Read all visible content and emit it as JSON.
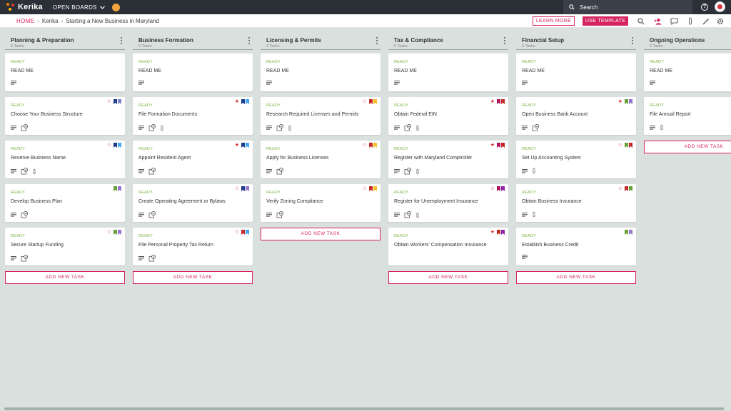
{
  "topbar": {
    "app_name": "Kerika",
    "open_boards_label": "OPEN BOARDS",
    "search_placeholder": "Search"
  },
  "breadcrumb": {
    "home": "HOME",
    "items": [
      "Kerika",
      "Starting a New Business in Maryland"
    ]
  },
  "actions": {
    "learn_more": "LEARN MORE",
    "use_template": "USE TEMPLATE"
  },
  "colors": {
    "accent": "#d6245e",
    "ready": "#7cb342",
    "topbar": "#2b2f36",
    "background": "#d9e0dd"
  },
  "add_task_label": "ADD NEW TASK",
  "columns": [
    {
      "title": "Planning & Preparation",
      "count": "5 Tasks",
      "cards": [
        {
          "status": "READY",
          "title": "READ ME",
          "star": "",
          "tags": [],
          "icons": [
            "chat"
          ]
        },
        {
          "status": "READY",
          "title": "Choose Your Business Structure",
          "star": "☆",
          "tags": [
            "#1e3a8a",
            "#7986cb"
          ],
          "icons": [
            "chat",
            "checklist"
          ]
        },
        {
          "status": "READY",
          "title": "Reserve Business Name",
          "star": "☆",
          "tags": [
            "#1e3a8a",
            "#42a5f5"
          ],
          "icons": [
            "chat",
            "checklist",
            "attachment"
          ]
        },
        {
          "status": "READY",
          "title": "Develop Business Plan",
          "star": "",
          "tags": [
            "#689f38",
            "#9575cd"
          ],
          "icons": [
            "chat",
            "checklist"
          ]
        },
        {
          "status": "READY",
          "title": "Secure Startup Funding",
          "star": "☆",
          "tags": [
            "#689f38",
            "#9575cd"
          ],
          "icons": [
            "chat",
            "checklist"
          ]
        }
      ]
    },
    {
      "title": "Business Formation",
      "count": "5 Tasks",
      "cards": [
        {
          "status": "READY",
          "title": "READ ME",
          "star": "",
          "tags": [],
          "icons": [
            "chat"
          ]
        },
        {
          "status": "READY",
          "title": "File Formation Documents",
          "star": "★",
          "tags": [
            "#1e3a8a",
            "#42a5f5"
          ],
          "icons": [
            "chat",
            "checklist",
            "attachment"
          ]
        },
        {
          "status": "READY",
          "title": "Appoint Resident Agent",
          "star": "★",
          "tags": [
            "#1e3a8a",
            "#42a5f5"
          ],
          "icons": [
            "chat",
            "checklist"
          ]
        },
        {
          "status": "READY",
          "title": "Create Operating Agreement or Bylaws",
          "star": "☆",
          "tags": [
            "#1e3a8a",
            "#9575cd"
          ],
          "icons": [
            "chat",
            "checklist"
          ]
        },
        {
          "status": "READY",
          "title": "File Personal Property Tax Return",
          "star": "☆",
          "tags": [
            "#c62828",
            "#42a5f5"
          ],
          "icons": [
            "chat",
            "checklist"
          ]
        }
      ]
    },
    {
      "title": "Licensing & Permits",
      "count": "4 Tasks",
      "cards": [
        {
          "status": "READY",
          "title": "READ ME",
          "star": "",
          "tags": [],
          "icons": [
            "chat"
          ]
        },
        {
          "status": "READY",
          "title": "Research Required Licenses and Permits",
          "star": "☆",
          "tags": [
            "#c62828",
            "#fbc02d"
          ],
          "icons": [
            "chat",
            "checklist",
            "attachment"
          ]
        },
        {
          "status": "READY",
          "title": "Apply for Business Licenses",
          "star": "☆",
          "tags": [
            "#c62828",
            "#fbc02d"
          ],
          "icons": [
            "chat",
            "checklist"
          ]
        },
        {
          "status": "READY",
          "title": "Verify Zoning Compliance",
          "star": "☆",
          "tags": [
            "#c62828",
            "#fbc02d"
          ],
          "icons": [
            "chat",
            "checklist"
          ]
        }
      ]
    },
    {
      "title": "Tax & Compliance",
      "count": "5 Tasks",
      "cards": [
        {
          "status": "READY",
          "title": "READ ME",
          "star": "",
          "tags": [],
          "icons": [
            "chat"
          ]
        },
        {
          "status": "READY",
          "title": "Obtain Federal EIN",
          "star": "★",
          "tags": [
            "#ad1457",
            "#c62828"
          ],
          "icons": [
            "chat",
            "checklist",
            "attachment"
          ]
        },
        {
          "status": "READY",
          "title": "Register with Maryland Comptroller",
          "star": "★",
          "tags": [
            "#ad1457",
            "#c62828"
          ],
          "icons": [
            "chat",
            "checklist",
            "attachment"
          ]
        },
        {
          "status": "READY",
          "title": "Register for Unemployment Insurance",
          "star": "☆",
          "tags": [
            "#ad1457",
            "#8e24aa"
          ],
          "icons": [
            "chat",
            "checklist",
            "attachment"
          ]
        },
        {
          "status": "READY",
          "title": "Obtain Workers' Compensation Insurance",
          "star": "★",
          "tags": [
            "#c62828",
            "#8e24aa"
          ],
          "icons": []
        }
      ]
    },
    {
      "title": "Financial Setup",
      "count": "5 Tasks",
      "cards": [
        {
          "status": "READY",
          "title": "READ ME",
          "star": "",
          "tags": [],
          "icons": [
            "chat"
          ]
        },
        {
          "status": "READY",
          "title": "Open Business Bank Account",
          "star": "★",
          "tags": [
            "#689f38",
            "#9575cd"
          ],
          "icons": [
            "chat",
            "checklist"
          ]
        },
        {
          "status": "READY",
          "title": "Set Up Accounting System",
          "star": "☆",
          "tags": [
            "#689f38",
            "#c62828"
          ],
          "icons": [
            "chat",
            "attachment"
          ]
        },
        {
          "status": "READY",
          "title": "Obtain Business Insurance",
          "star": "☆",
          "tags": [
            "#c62828",
            "#689f38"
          ],
          "icons": [
            "chat",
            "attachment"
          ]
        },
        {
          "status": "READY",
          "title": "Establish Business Credit",
          "star": "",
          "tags": [
            "#689f38",
            "#9575cd"
          ],
          "icons": [
            "chat"
          ]
        }
      ]
    },
    {
      "title": "Ongoing Operations",
      "count": "2 Tasks",
      "cards": [
        {
          "status": "READY",
          "title": "READ ME",
          "star": "",
          "tags": [],
          "icons": [
            "chat"
          ]
        },
        {
          "status": "READY",
          "title": "File Annual Report",
          "star": "",
          "tags": [],
          "icons": [
            "chat",
            "attachment"
          ]
        }
      ]
    }
  ]
}
